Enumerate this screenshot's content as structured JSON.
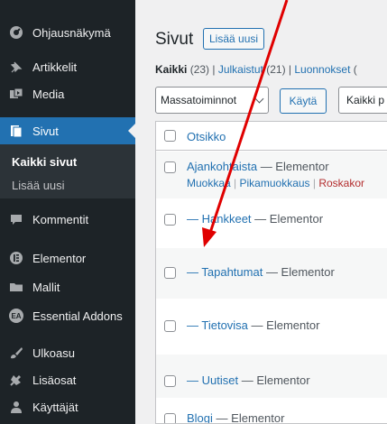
{
  "sidebar": {
    "items": [
      {
        "label": "Ohjausnäkymä",
        "icon": "dashboard-icon"
      },
      {
        "label": "Artikkelit",
        "icon": "pin-icon"
      },
      {
        "label": "Media",
        "icon": "media-icon"
      },
      {
        "label": "Sivut",
        "icon": "page-icon"
      },
      {
        "label": "Kommentit",
        "icon": "comment-icon"
      },
      {
        "label": "Elementor",
        "icon": "elementor-icon"
      },
      {
        "label": "Mallit",
        "icon": "folder-icon"
      },
      {
        "label": "Essential Addons",
        "icon": "ea-icon",
        "badge": "EA"
      },
      {
        "label": "Ulkoasu",
        "icon": "brush-icon"
      },
      {
        "label": "Lisäosat",
        "icon": "plugin-icon"
      },
      {
        "label": "Käyttäjät",
        "icon": "users-icon"
      }
    ],
    "submenu": {
      "all_pages": "Kaikki sivut",
      "add_new": "Lisää uusi"
    }
  },
  "main": {
    "title": "Sivut",
    "add_new": "Lisää uusi",
    "views": {
      "all_label": "Kaikki",
      "all_count": "(23)",
      "published_label": "Julkaistut",
      "published_count": "(21)",
      "drafts_label": "Luonnokset",
      "drafts_count": "("
    },
    "bulk_actions": "Massatoiminnot",
    "apply": "Käytä",
    "date_filter": "Kaikki p",
    "column_title": "Otsikko",
    "rows": [
      {
        "title": "Ajankohtaista",
        "suffix": "— Elementor"
      },
      {
        "title": "— Hankkeet",
        "suffix": "— Elementor"
      },
      {
        "title": "— Tapahtumat",
        "suffix": "— Elementor"
      },
      {
        "title": "— Tietovisa",
        "suffix": "— Elementor"
      },
      {
        "title": "— Uutiset",
        "suffix": "— Elementor"
      },
      {
        "title": "Blogi",
        "suffix": "— Elementor"
      }
    ],
    "row_actions": {
      "edit": "Muokkaa",
      "quick_edit": "Pikamuokkaus",
      "trash": "Roskakor"
    }
  },
  "colors": {
    "sidebar_bg": "#1d2327",
    "accent": "#2271b1",
    "trash": "#b32d2e",
    "annotation_arrow": "#e00000"
  }
}
